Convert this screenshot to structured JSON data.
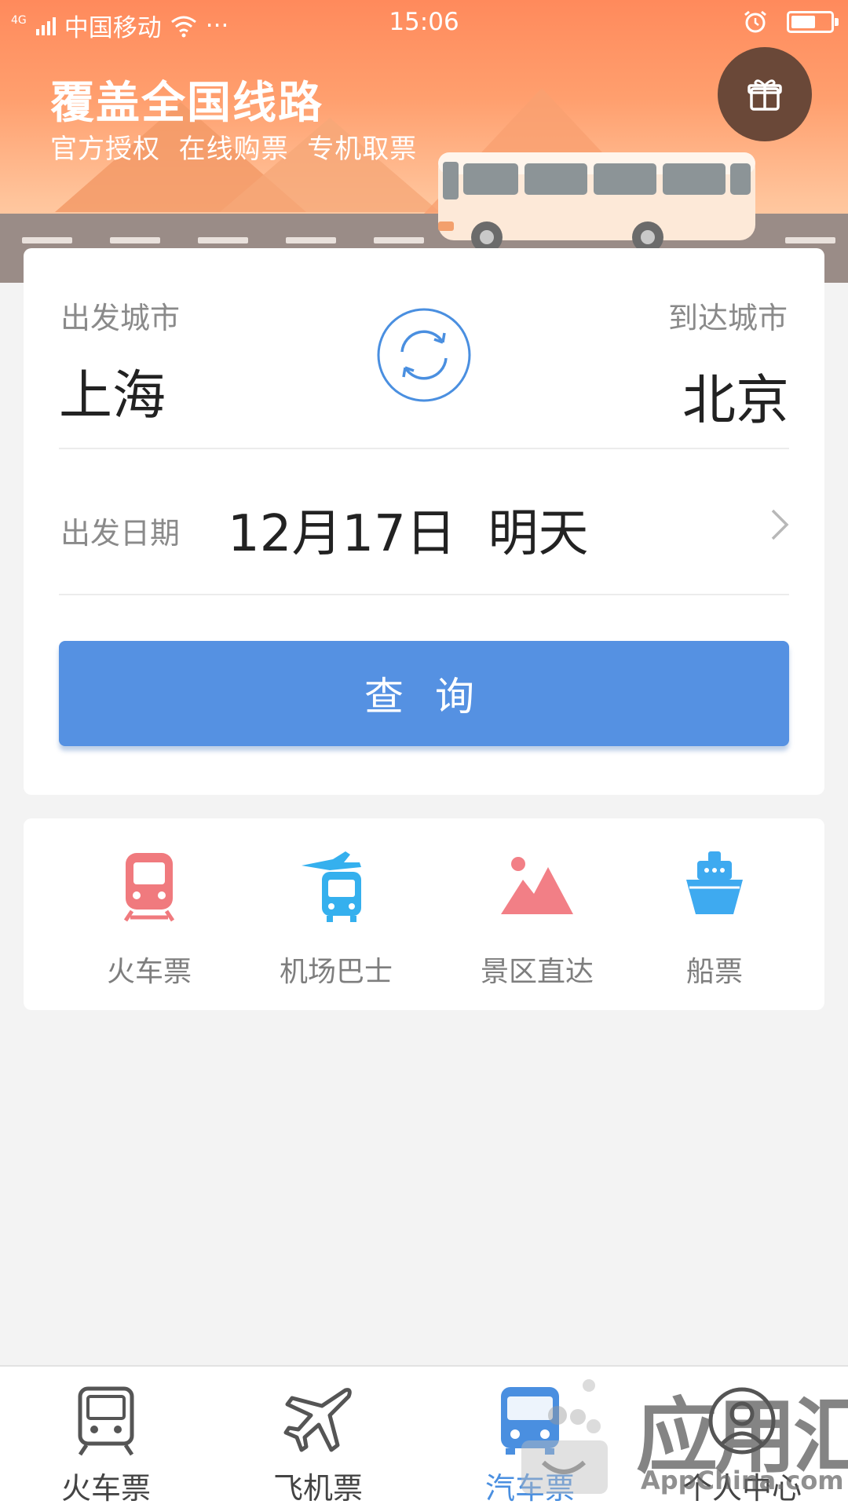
{
  "status_bar": {
    "network": "4G",
    "carrier": "中国移动",
    "more": "···",
    "time": "15:06",
    "battery_level": 0.55
  },
  "banner": {
    "title": "覆盖全国线路",
    "subtitle": "官方授权  在线购票  专机取票"
  },
  "route": {
    "from_label": "出发城市",
    "from_city": "上海",
    "to_label": "到达城市",
    "to_city": "北京",
    "date_label": "出发日期",
    "date_value": "12月17日  明天",
    "search_button": "查 询"
  },
  "services": [
    {
      "label": "火车票",
      "icon": "train-icon",
      "color": "#f07a7e"
    },
    {
      "label": "机场巴士",
      "icon": "airport-bus-icon",
      "color": "#35b0ee"
    },
    {
      "label": "景区直达",
      "icon": "scenic-mountain-icon",
      "color": "#f27f86"
    },
    {
      "label": "船票",
      "icon": "ship-icon",
      "color": "#3eaaf0"
    }
  ],
  "tabs": [
    {
      "label": "火车票",
      "icon": "train-tab-icon",
      "active": false
    },
    {
      "label": "飞机票",
      "icon": "plane-tab-icon",
      "active": false
    },
    {
      "label": "汽车票",
      "icon": "bus-tab-icon",
      "active": true
    },
    {
      "label": "个人中心",
      "icon": "profile-tab-icon",
      "active": false
    }
  ],
  "watermark": {
    "text": "应用汇",
    "sub": "AppChina.com"
  },
  "colors": {
    "primary": "#5591e2",
    "banner_top": "#ff8a5c",
    "gift_bg": "#6a4838"
  }
}
